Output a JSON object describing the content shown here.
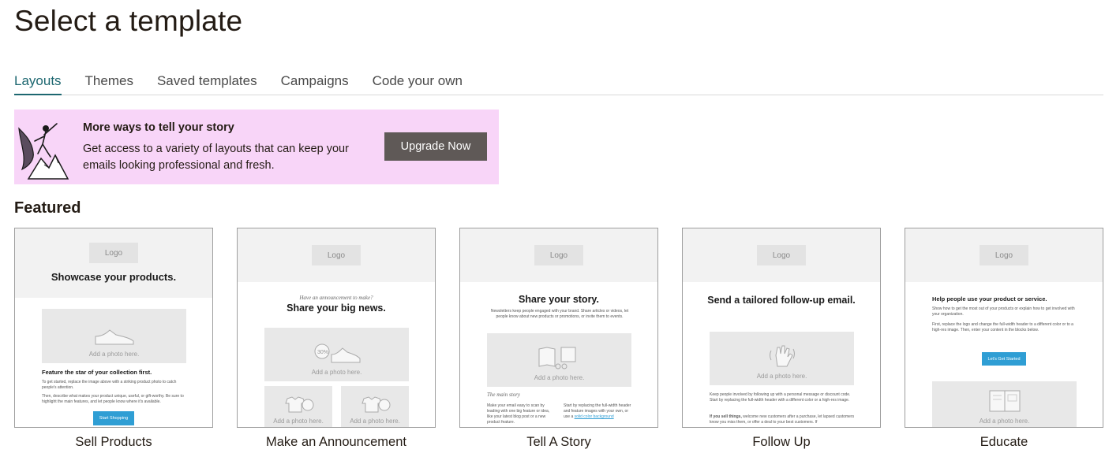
{
  "page": {
    "title": "Select a template"
  },
  "tabs": [
    {
      "label": "Layouts",
      "active": true
    },
    {
      "label": "Themes",
      "active": false
    },
    {
      "label": "Saved templates",
      "active": false
    },
    {
      "label": "Campaigns",
      "active": false
    },
    {
      "label": "Code your own",
      "active": false
    }
  ],
  "banner": {
    "heading": "More ways to tell your story",
    "text": "Get access to a variety of layouts that can keep your emails looking professional and fresh.",
    "button_label": "Upgrade Now",
    "background": "#f8d5f8"
  },
  "featured": {
    "heading": "Featured"
  },
  "colors": {
    "accent": "#1d6770",
    "button_dark": "#5f5957",
    "template_button": "#2f9ed4"
  },
  "templates": [
    {
      "caption": "Sell Products",
      "logo": "Logo",
      "headline": "Showcase your products.",
      "photo_label": "Add a photo here.",
      "subheading": "Feature the star of your collection first.",
      "body1": "To get started, replace the image above with a striking product photo to catch people's attention.",
      "body2": "Then, describe what makes your product unique, useful, or gift-worthy. Be sure to highlight the main features, and let people know where it's available.",
      "button": "Start Shopping"
    },
    {
      "caption": "Make an Announcement",
      "logo": "Logo",
      "kicker": "Have an announcement to make?",
      "headline": "Share your big news.",
      "photo_label": "Add a photo here.",
      "photo_label_small1": "Add a photo here.",
      "photo_label_small2": "Add a photo here."
    },
    {
      "caption": "Tell A Story",
      "logo": "Logo",
      "headline": "Share your story.",
      "intro": "Newsletters keep people engaged with your brand. Share articles or videos, let people know about new products or promotions, or invite them to events.",
      "photo_label": "Add a photo here.",
      "section": "The main story",
      "col1": "Make your email easy to scan by leading with one big feature or idea, like your latest blog post or a new product feature.",
      "col2": "Start by replacing the full-width header and feature images with your own, or use a",
      "col2_link": "solid color background"
    },
    {
      "caption": "Follow Up",
      "logo": "Logo",
      "headline": "Send a tailored follow-up email.",
      "photo_label": "Add a photo here.",
      "body1": "Keep people involved by following up with a personal message or discount code. Start by replacing the full-width header with a different color or a high-res image.",
      "body2_bold": "If you sell things,",
      "body2": "welcome new customers after a purchase, let lapsed customers know you miss them, or offer a deal to your best customers. If"
    },
    {
      "caption": "Educate",
      "logo": "Logo",
      "headline": "Help people use your product or service.",
      "body1": "Show how to get the most out of your products or explain how to get involved with your organization.",
      "body2": "First, replace the logo and change the full-width header to a different color or to a high-res image. Then, enter your content in the blocks below.",
      "button": "Let's Get Started",
      "photo_label": "Add a photo here."
    }
  ]
}
